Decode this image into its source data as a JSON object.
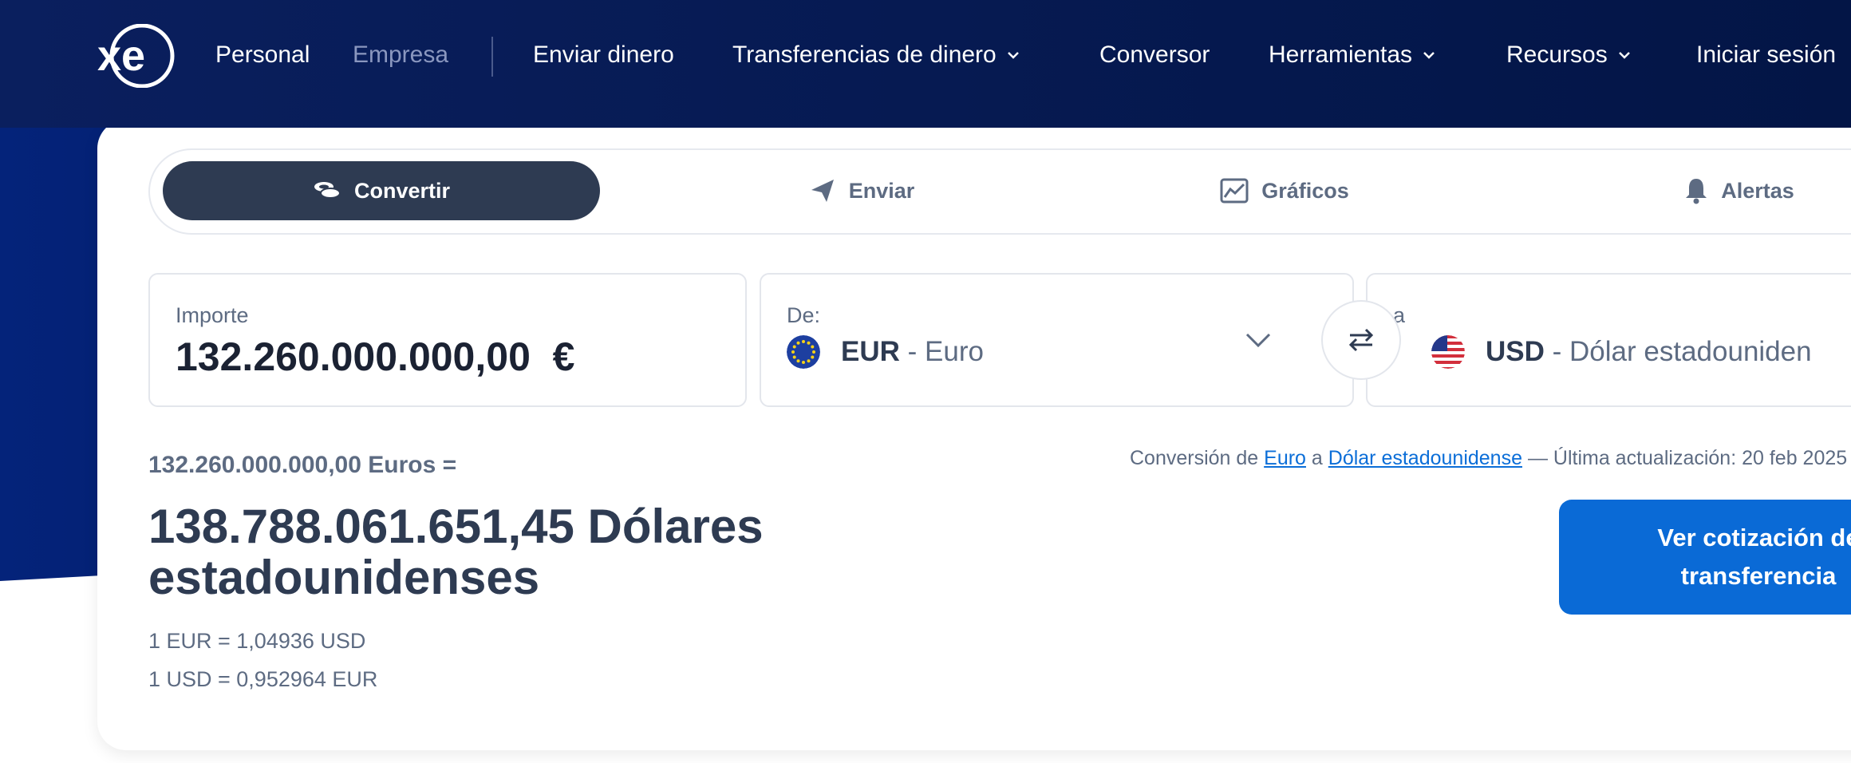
{
  "nav": {
    "logo_text": "xe",
    "personal": "Personal",
    "empresa": "Empresa",
    "enviar_dinero": "Enviar dinero",
    "transferencias": "Transferencias de dinero",
    "conversor": "Conversor",
    "herramientas": "Herramientas",
    "recursos": "Recursos",
    "iniciar_sesion": "Iniciar sesión"
  },
  "tabs": {
    "convertir": "Convertir",
    "enviar": "Enviar",
    "graficos": "Gráficos",
    "alertas": "Alertas"
  },
  "converter": {
    "amount_label": "Importe",
    "amount_value": "132.260.000.000,00",
    "amount_symbol": "€",
    "from_label": "De:",
    "from_code": "EUR",
    "from_name": "Euro",
    "to_label": "a",
    "to_code": "USD",
    "to_name": "Dólar estadouniden"
  },
  "result": {
    "from_line": "132.260.000.000,00 Euros =",
    "big_result": "138.788.061.651,45 Dólares estadounidenses",
    "rate1": "1 EUR = 1,04936 USD",
    "rate2": "1 USD = 0,952964 EUR"
  },
  "note": {
    "prefix": "Conversión de ",
    "link1": "Euro",
    "mid": " a ",
    "link2": "Dólar estadounidense",
    "suffix": " — Última actualización: 20 feb 2025"
  },
  "cta": {
    "label": "Ver cotización de transferencia"
  },
  "colors": {
    "navy": "#061a52",
    "accent_blue": "#0a6ad6",
    "active_tab": "#2e3b52"
  }
}
